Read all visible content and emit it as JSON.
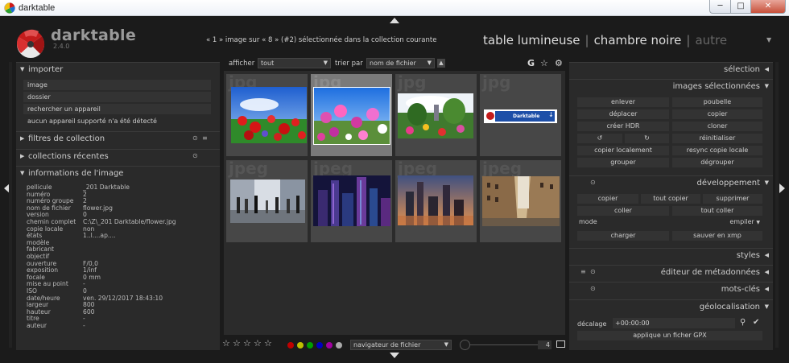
{
  "window": {
    "title": "darktable",
    "min": "─",
    "max": "□",
    "close": "✕"
  },
  "header": {
    "brand": "darktable",
    "version": "2.4.0",
    "status": "« 1 » image sur « 8 » (#2) sélectionnée dans la collection courante",
    "views": {
      "lighttable": "table lumineuse",
      "darkroom": "chambre noire",
      "other": "autre",
      "sep": "|"
    }
  },
  "left": {
    "import": {
      "title": "importer",
      "buttons": [
        "image",
        "dossier",
        "rechercher un appareil",
        "aucun appareil supporté n'a été détecté"
      ]
    },
    "collection_filters": "filtres de collection",
    "recent_collections": "collections récentes",
    "image_info": {
      "title": "informations de l'image",
      "rows": [
        {
          "k": "pellicule",
          "v": "_201 Darktable"
        },
        {
          "k": "numéro",
          "v": "2"
        },
        {
          "k": "numéro groupe",
          "v": "2"
        },
        {
          "k": "nom de fichier",
          "v": "flower.jpg"
        },
        {
          "k": "version",
          "v": "0"
        },
        {
          "k": "chemin complet",
          "v": "C:\\Z\\_201 Darktable/flower.jpg"
        },
        {
          "k": "copie locale",
          "v": "non"
        },
        {
          "k": "états",
          "v": "1..l....ap...."
        },
        {
          "k": "modèle",
          "v": ""
        },
        {
          "k": "fabricant",
          "v": ""
        },
        {
          "k": "objectif",
          "v": ""
        },
        {
          "k": "ouverture",
          "v": "F/0,0"
        },
        {
          "k": "exposition",
          "v": "1/inf"
        },
        {
          "k": "focale",
          "v": "0 mm"
        },
        {
          "k": "mise au point",
          "v": "-"
        },
        {
          "k": "ISO",
          "v": "0"
        },
        {
          "k": "date/heure",
          "v": "ven. 29/12/2017 18:43:10"
        },
        {
          "k": "largeur",
          "v": "800"
        },
        {
          "k": "hauteur",
          "v": "600"
        },
        {
          "k": "titre",
          "v": "-"
        },
        {
          "k": "auteur",
          "v": "-"
        }
      ]
    }
  },
  "toolbar": {
    "show_label": "afficher",
    "show_value": "tout",
    "sort_label": "trier par",
    "sort_value": "nom de fichier",
    "sort_dir": "▲",
    "group_icon": "G"
  },
  "thumbs": [
    {
      "ext": "jpg",
      "selected": false,
      "dark": false
    },
    {
      "ext": "jpg",
      "selected": true,
      "dark": false
    },
    {
      "ext": "jpg",
      "selected": false,
      "dark": false
    },
    {
      "ext": "jpg",
      "selected": false,
      "dark": false
    },
    {
      "ext": "jpeg",
      "selected": false,
      "dark": false
    },
    {
      "ext": "jpeg",
      "selected": false,
      "dark": false
    },
    {
      "ext": "jpeg",
      "selected": false,
      "dark": false
    },
    {
      "ext": "jpeg",
      "selected": false,
      "dark": false
    }
  ],
  "thumb4_banner": "Darktable",
  "bottom": {
    "stars": "☆☆☆☆☆",
    "colors": [
      "#c00000",
      "#c0c000",
      "#00a000",
      "#0000c0",
      "#a000a0",
      "#aaaaaa"
    ],
    "view_mode": "navigateur de fichier",
    "zoom_count": "4"
  },
  "right": {
    "selection": "sélection",
    "selected_images": {
      "title": "images sélectionnées",
      "buttons": [
        "enlever",
        "poubelle",
        "déplacer",
        "copier",
        "créer HDR",
        "cloner",
        "réinitialiser",
        "copier localement",
        "resync copie locale",
        "grouper",
        "dégrouper"
      ]
    },
    "develop": {
      "title": "développement",
      "copy": "copier",
      "copy_all": "tout copier",
      "delete": "supprimer",
      "paste": "coller",
      "paste_all": "tout coller",
      "mode_label": "mode",
      "mode_value": "empiler",
      "load": "charger",
      "save_xmp": "sauver en xmp"
    },
    "styles": "styles",
    "metadata_editor": "éditeur de métadonnées",
    "tags": "mots-clés",
    "geolocation": {
      "title": "géolocalisation",
      "offset_label": "décalage",
      "offset_value": "+00:00:00",
      "apply_gpx": "applique un ficher GPX"
    }
  }
}
